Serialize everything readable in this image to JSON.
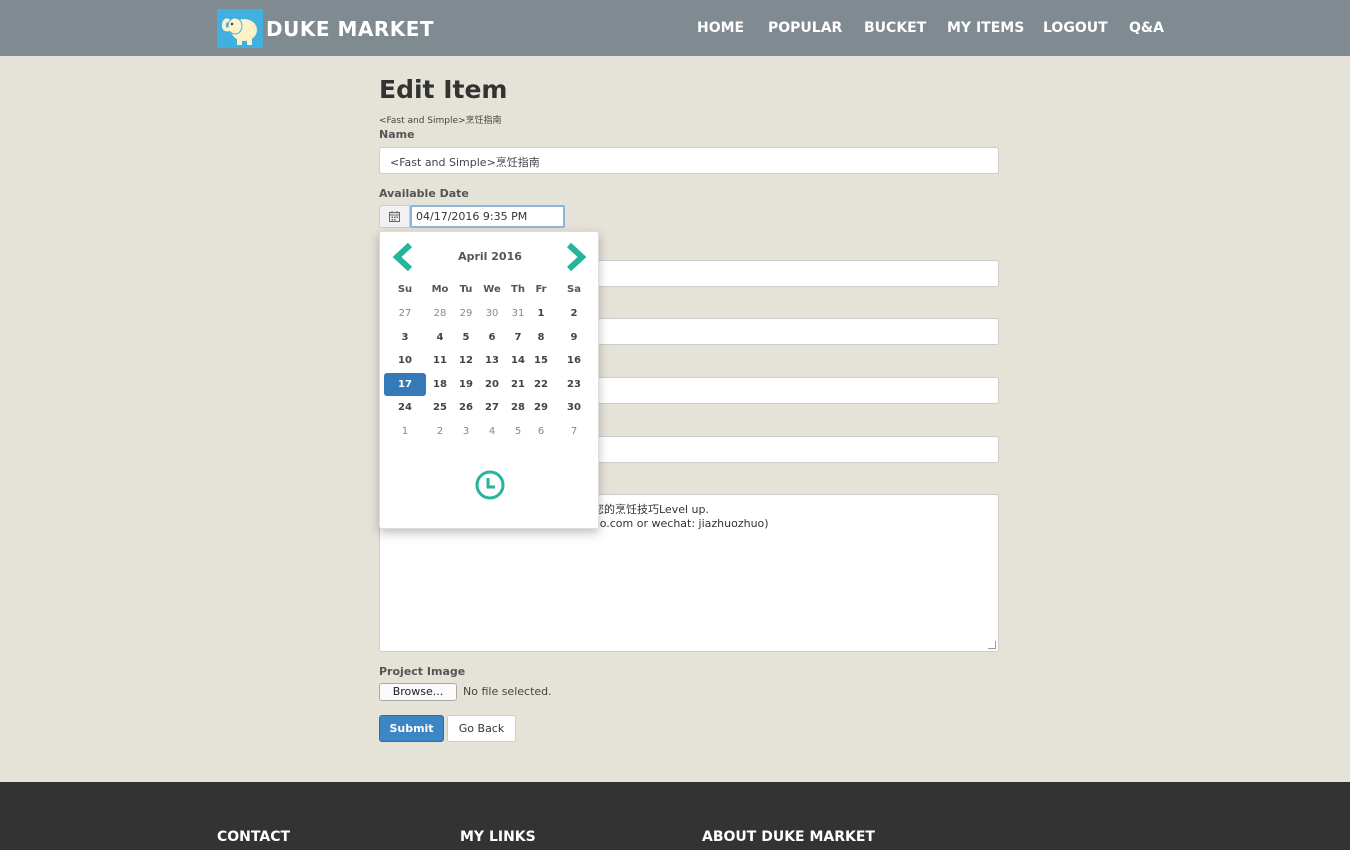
{
  "brand": {
    "name": "DUKE MARKET"
  },
  "nav": {
    "items": [
      "HOME",
      "POPULAR",
      "BUCKET",
      "MY ITEMS",
      "LOGOUT",
      "Q&A"
    ]
  },
  "form": {
    "title": "Edit Item",
    "item_subtitle": "<Fast and Simple>烹饪指南",
    "name_label": "Name",
    "name_value": "<Fast and Simple>烹饪指南",
    "date_label": "Available Date",
    "date_value": "04/17/2016 9:35 PM",
    "description_lines": [
      "您的烹饪技巧Level up.",
      "oo.com  or wechat: jiazhuozhuo)"
    ],
    "image_label": "Project Image",
    "browse_label": "Browse...",
    "no_file_text": "No file selected.",
    "submit_label": "Submit",
    "back_label": "Go Back"
  },
  "datepicker": {
    "month": "April 2016",
    "weekdays": [
      "Su",
      "Mo",
      "Tu",
      "We",
      "Th",
      "Fr",
      "Sa"
    ],
    "weeks": [
      [
        "27",
        "28",
        "29",
        "30",
        "31",
        "1",
        "2"
      ],
      [
        "3",
        "4",
        "5",
        "6",
        "7",
        "8",
        "9"
      ],
      [
        "10",
        "11",
        "12",
        "13",
        "14",
        "15",
        "16"
      ],
      [
        "17",
        "18",
        "19",
        "20",
        "21",
        "22",
        "23"
      ],
      [
        "24",
        "25",
        "26",
        "27",
        "28",
        "29",
        "30"
      ],
      [
        "1",
        "2",
        "3",
        "4",
        "5",
        "6",
        "7"
      ]
    ],
    "selected": "17",
    "accent": "#26b59b"
  },
  "footer": {
    "headings": [
      "CONTACT",
      "MY LINKS",
      "ABOUT DUKE MARKET"
    ]
  },
  "colors": {
    "navbar": "#7f8a91",
    "background": "#e5e2d7",
    "primary": "#3d86c6",
    "footer": "#333333"
  }
}
